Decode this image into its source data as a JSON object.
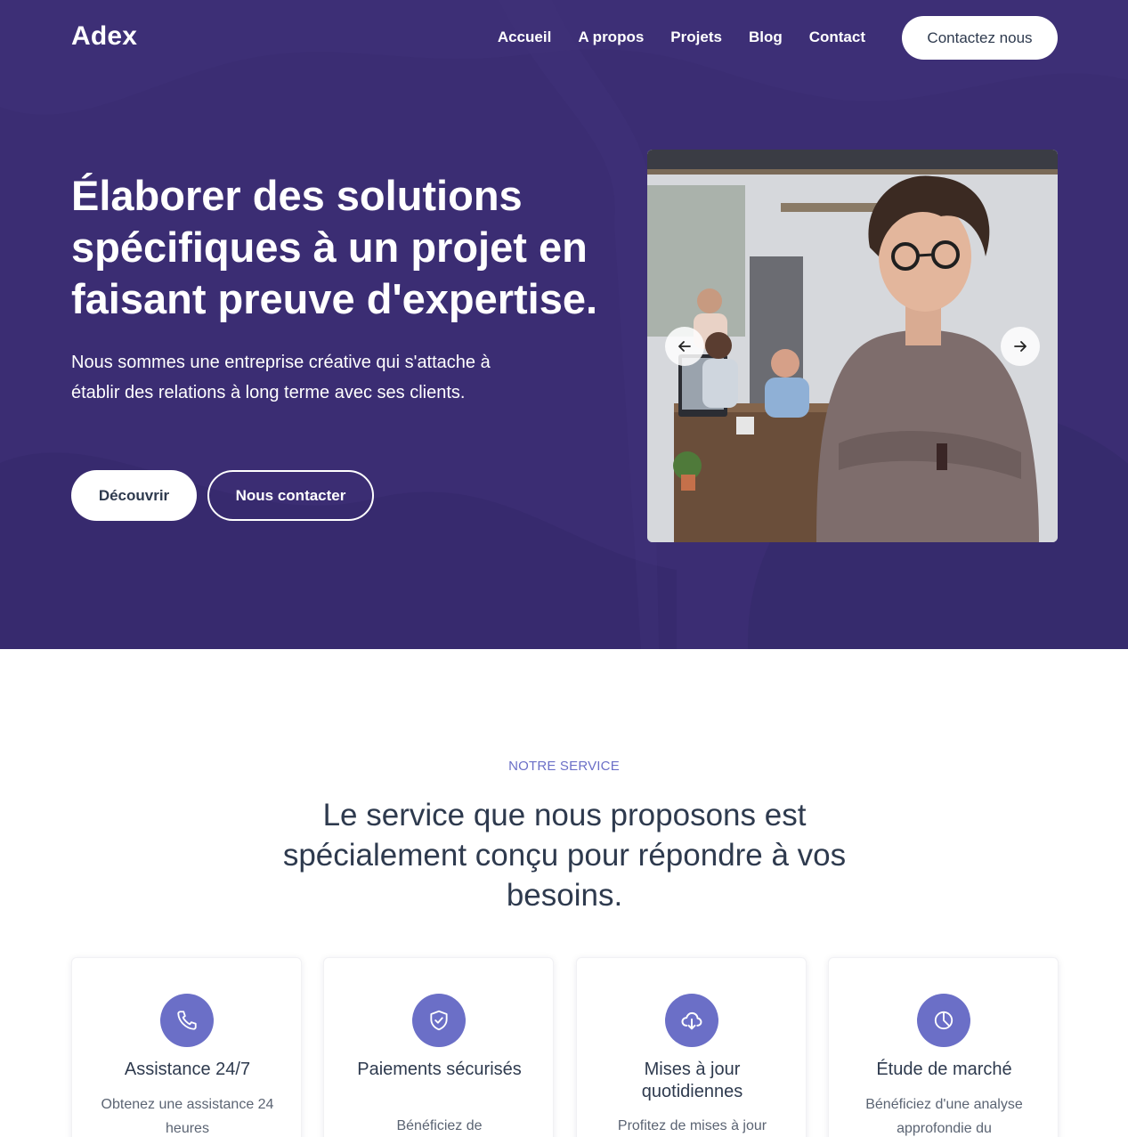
{
  "header": {
    "logo": "Adex",
    "nav": [
      "Accueil",
      "A propos",
      "Projets",
      "Blog",
      "Contact"
    ],
    "cta_label": "Contactez nous"
  },
  "hero": {
    "title": "Élaborer des solutions spécifiques à un projet en faisant preuve d'expertise.",
    "subtitle": "Nous sommes une entreprise créative qui s'attache à établir des relations à long terme avec ses clients.",
    "primary_button": "Découvrir",
    "secondary_button": "Nous contacter",
    "background_color": "#3b2d73"
  },
  "services": {
    "eyebrow": "NOTRE SERVICE",
    "title": "Le service que nous proposons est spécialement conçu pour répondre à vos besoins.",
    "accent_color": "#6b6fc7",
    "cards": [
      {
        "icon": "phone-icon",
        "title": "Assistance 24/7",
        "desc": "Obtenez une assistance 24 heures"
      },
      {
        "icon": "shield-check-icon",
        "title": "Paiements sécurisés",
        "desc": "Bénéficiez de"
      },
      {
        "icon": "cloud-download-icon",
        "title": "Mises à jour quotidiennes",
        "desc": "Profitez de mises à jour"
      },
      {
        "icon": "pie-chart-icon",
        "title": "Étude de marché",
        "desc": "Bénéficiez d'une analyse approfondie du"
      }
    ]
  }
}
